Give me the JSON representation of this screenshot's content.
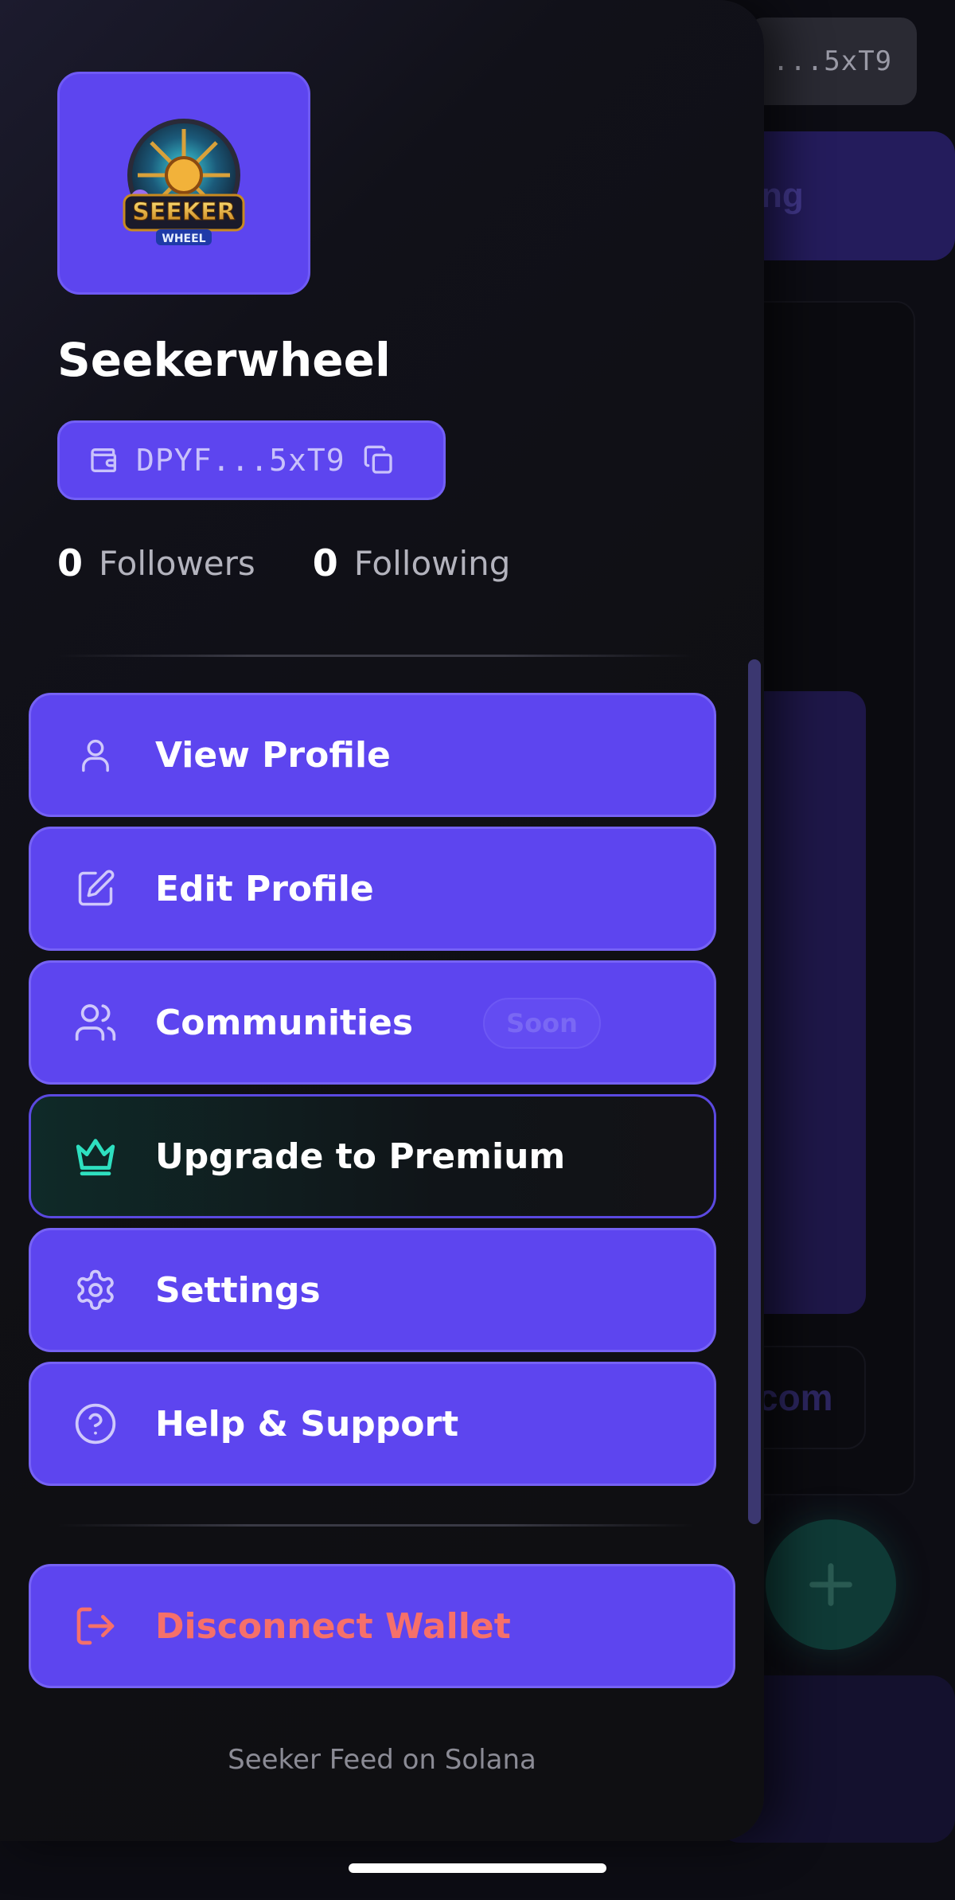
{
  "background": {
    "wallet_short": "...5xT9",
    "tab_label": "ng",
    "link_label": "com",
    "fab_icon": "plus-icon"
  },
  "profile": {
    "username": "Seekerwheel",
    "avatar_alt": "SEEKER WHEEL",
    "wallet_address": "DPYF...5xT9",
    "followers_count": "0",
    "followers_label": "Followers",
    "following_count": "0",
    "following_label": "Following"
  },
  "menu": {
    "items": [
      {
        "label": "View Profile",
        "icon": "user-icon"
      },
      {
        "label": "Edit Profile",
        "icon": "edit-icon"
      },
      {
        "label": "Communities",
        "icon": "users-icon",
        "badge": "Soon"
      },
      {
        "label": "Upgrade to Premium",
        "icon": "crown-icon"
      },
      {
        "label": "Settings",
        "icon": "gear-icon"
      },
      {
        "label": "Help & Support",
        "icon": "help-icon"
      }
    ]
  },
  "disconnect": {
    "label": "Disconnect Wallet",
    "icon": "logout-icon"
  },
  "footer": {
    "text": "Seeker Feed on Solana"
  },
  "colors": {
    "accent": "#5d45ef",
    "danger": "#f6706a",
    "premium": "#2ee0c0"
  }
}
